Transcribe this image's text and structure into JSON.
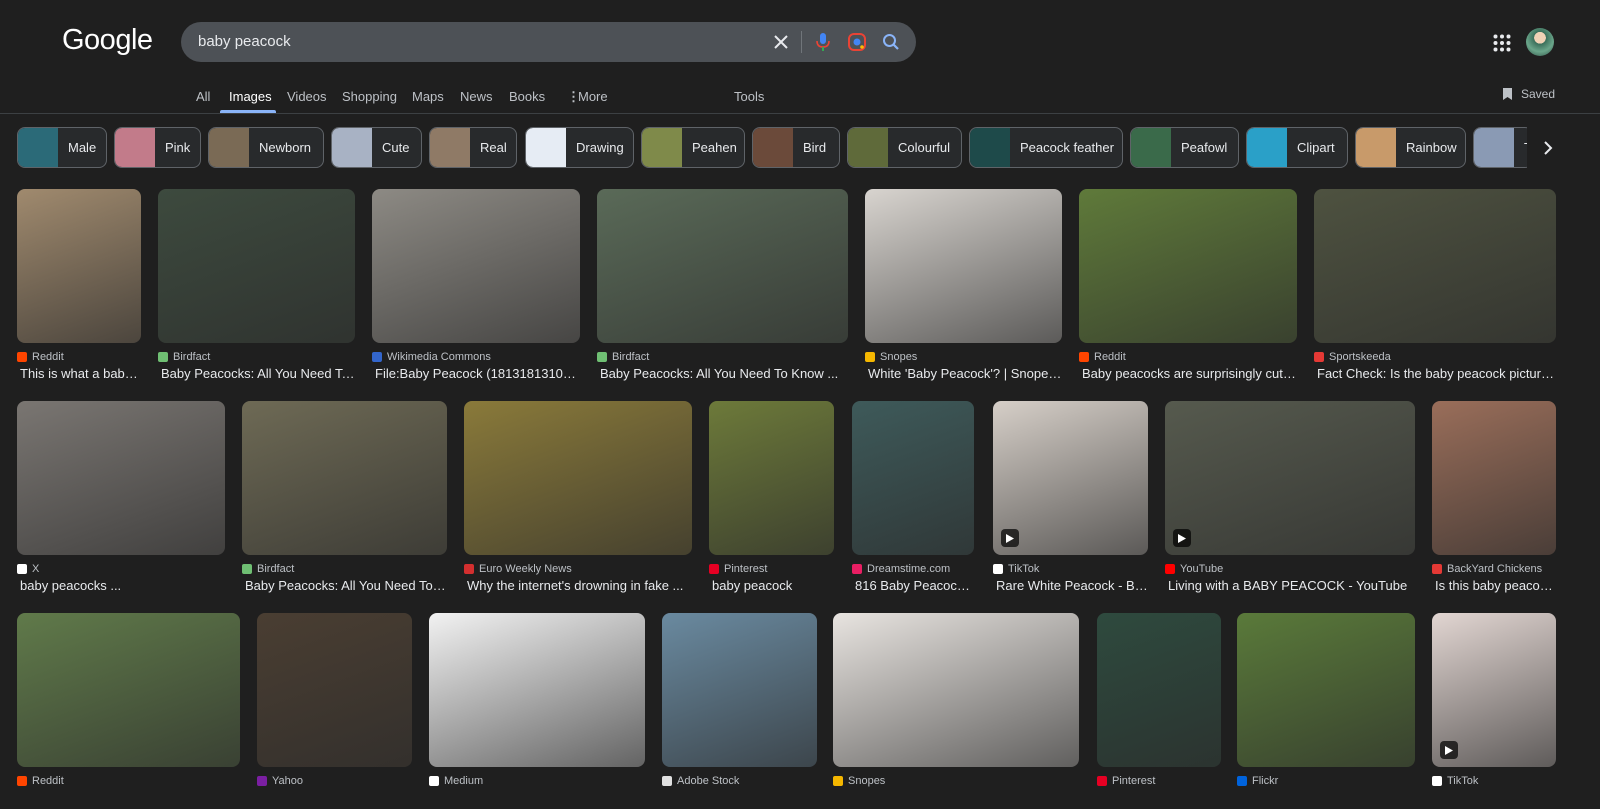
{
  "header": {
    "logo": "Google",
    "query": "baby peacock"
  },
  "tabs": [
    {
      "label": "All",
      "active": false
    },
    {
      "label": "Images",
      "active": true
    },
    {
      "label": "Videos",
      "active": false
    },
    {
      "label": "Shopping",
      "active": false
    },
    {
      "label": "Maps",
      "active": false
    },
    {
      "label": "News",
      "active": false
    },
    {
      "label": "Books",
      "active": false
    },
    {
      "label": "More",
      "active": false
    },
    {
      "label": "Tools",
      "active": false
    }
  ],
  "saved_label": "Saved",
  "chips": [
    {
      "label": "Male",
      "color": "#2b6a78"
    },
    {
      "label": "Pink",
      "color": "#c27b8a"
    },
    {
      "label": "Newborn",
      "color": "#7a6a55"
    },
    {
      "label": "Cute",
      "color": "#a8b2c4"
    },
    {
      "label": "Real",
      "color": "#8f7a66"
    },
    {
      "label": "Drawing",
      "color": "#e6ecf4"
    },
    {
      "label": "Peahen",
      "color": "#7f8a4a"
    },
    {
      "label": "Bird",
      "color": "#6b4a3a"
    },
    {
      "label": "Colourful",
      "color": "#5f6a3a"
    },
    {
      "label": "Peacock feather",
      "color": "#1e4a4a"
    },
    {
      "label": "Peafowl",
      "color": "#3a6a4a"
    },
    {
      "label": "Clipart",
      "color": "#2aa0c8"
    },
    {
      "label": "Rainbow",
      "color": "#c89a6a"
    },
    {
      "label": "T",
      "color": "#8a9ab4"
    }
  ],
  "results": [
    {
      "source": "Reddit",
      "title": "This is what a baby ...",
      "fav": "#ff4500",
      "bg": "#a08a6e",
      "video": false
    },
    {
      "source": "Birdfact",
      "title": "Baby Peacocks: All You Need To ...",
      "fav": "#6fbf73",
      "bg": "#3d4a3e",
      "video": false
    },
    {
      "source": "Wikimedia Commons",
      "title": "File:Baby Peacock (18131813108)....",
      "fav": "#3366cc",
      "bg": "#8d8a84",
      "video": false
    },
    {
      "source": "Birdfact",
      "title": "Baby Peacocks: All You Need To Know ...",
      "fav": "#6fbf73",
      "bg": "#5a6a58",
      "video": false
    },
    {
      "source": "Snopes",
      "title": "White 'Baby Peacock'? | Snopes ...",
      "fav": "#f5b700",
      "bg": "#d8d4cf",
      "video": false
    },
    {
      "source": "Reddit",
      "title": "Baby peacocks are surprisingly cute ...",
      "fav": "#ff4500",
      "bg": "#5f7a3a",
      "video": false
    },
    {
      "source": "Sportskeeda",
      "title": "Fact Check: Is the baby peacock picture ...",
      "fav": "#e53935",
      "bg": "#4e5240",
      "video": false
    },
    {
      "source": "X",
      "title": "baby peacocks ...",
      "fav": "#ffffff",
      "bg": "#7a7672",
      "video": false
    },
    {
      "source": "Birdfact",
      "title": "Baby Peacocks: All You Need To K...",
      "fav": "#6fbf73",
      "bg": "#6e6a55",
      "video": false
    },
    {
      "source": "Euro Weekly News",
      "title": "Why the internet's drowning in fake ...",
      "fav": "#d32f2f",
      "bg": "#8a7a3a",
      "video": false
    },
    {
      "source": "Pinterest",
      "title": "baby peacock",
      "fav": "#e60023",
      "bg": "#6d7a3a",
      "video": false
    },
    {
      "source": "Dreamstime.com",
      "title": "816 Baby Peacock ...",
      "fav": "#e91e63",
      "bg": "#3e5a5a",
      "video": false
    },
    {
      "source": "TikTok",
      "title": "Rare White Peacock - Bab...",
      "fav": "#ffffff",
      "bg": "#d6cfc8",
      "video": true
    },
    {
      "source": "YouTube",
      "title": "Living with a BABY PEACOCK - YouTube",
      "fav": "#ff0000",
      "bg": "#565a4e",
      "video": true
    },
    {
      "source": "BackYard Chickens",
      "title": "Is this baby peacoc...",
      "fav": "#e53935",
      "bg": "#9a6e5a",
      "video": false
    },
    {
      "source": "Reddit",
      "title": "",
      "fav": "#ff4500",
      "bg": "#607a4a",
      "video": false
    },
    {
      "source": "Yahoo",
      "title": "",
      "fav": "#7b1fa2",
      "bg": "#4a3e32",
      "video": false
    },
    {
      "source": "Medium",
      "title": "",
      "fav": "#ffffff",
      "bg": "#f2f2f2",
      "video": false
    },
    {
      "source": "Adobe Stock",
      "title": "",
      "fav": "#e0e0e0",
      "bg": "#6a8aa0",
      "video": false
    },
    {
      "source": "Snopes",
      "title": "",
      "fav": "#f5b700",
      "bg": "#e8e4e0",
      "video": false
    },
    {
      "source": "Pinterest",
      "title": "",
      "fav": "#e60023",
      "bg": "#2e4a3e",
      "video": false
    },
    {
      "source": "Flickr",
      "title": "",
      "fav": "#0063dc",
      "bg": "#5a7a3a",
      "video": false
    },
    {
      "source": "TikTok",
      "title": "",
      "fav": "#ffffff",
      "bg": "#e2d6d2",
      "video": true
    }
  ]
}
